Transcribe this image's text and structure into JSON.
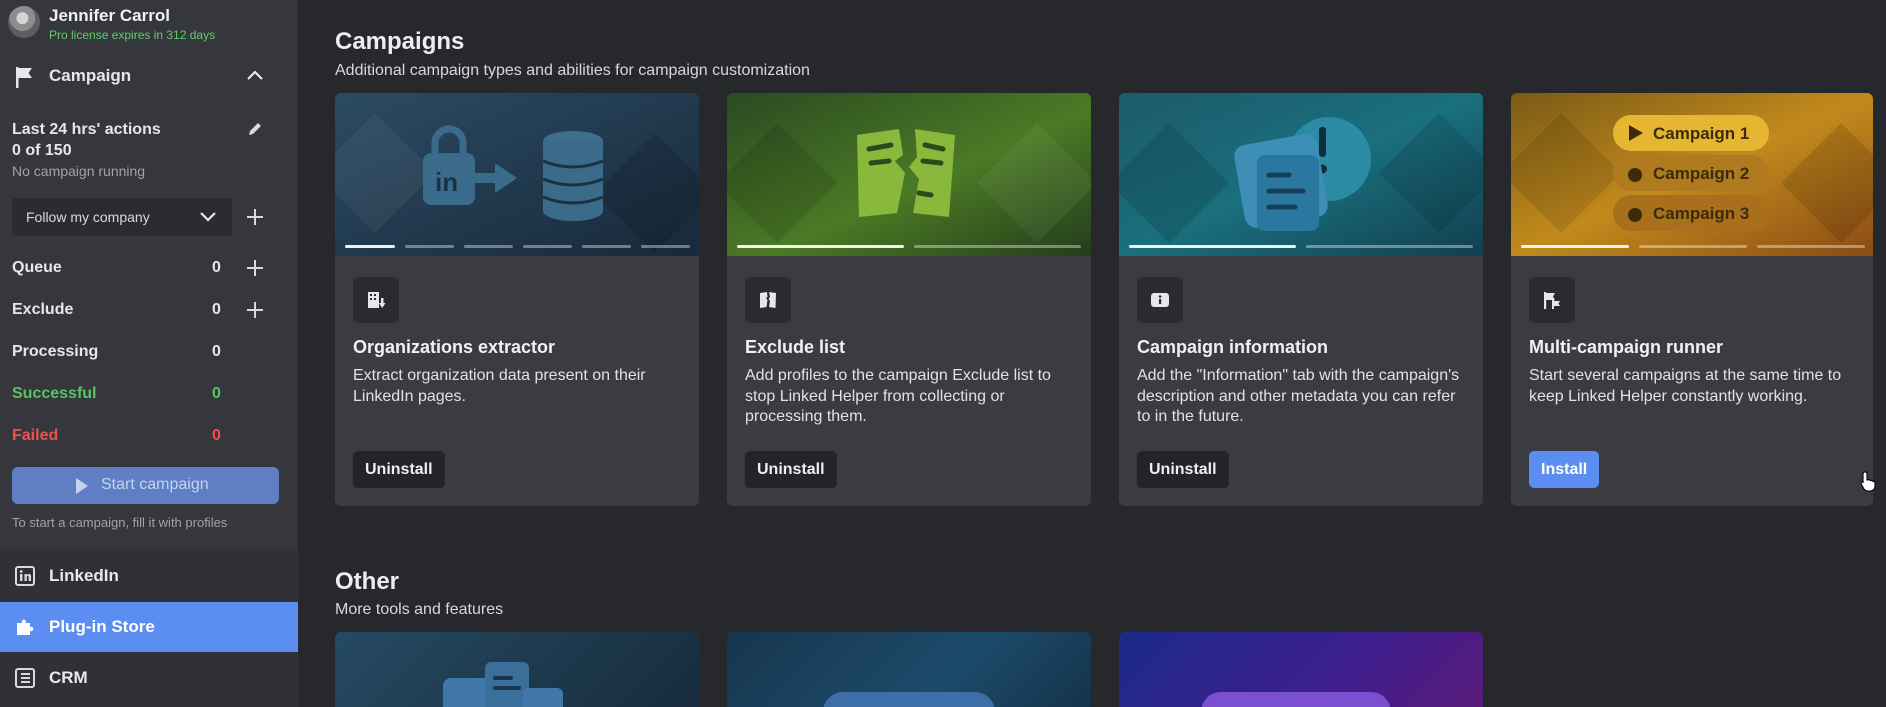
{
  "user": {
    "name": "Jennifer Carrol",
    "license": "Pro license expires in 312 days"
  },
  "sidebar": {
    "section_label": "Campaign",
    "actions_title": "Last 24 hrs' actions",
    "actions_count": "0 of 150",
    "status_text": "No campaign running",
    "campaign_select": "Follow my company",
    "stats": [
      {
        "label": "Queue",
        "value": "0"
      },
      {
        "label": "Exclude",
        "value": "0"
      },
      {
        "label": "Processing",
        "value": "0"
      },
      {
        "label": "Successful",
        "value": "0"
      },
      {
        "label": "Failed",
        "value": "0"
      }
    ],
    "start_button": "Start campaign",
    "hint": "To start a campaign, fill it with profiles",
    "nav": [
      {
        "label": "LinkedIn",
        "icon": "linkedin-icon"
      },
      {
        "label": "Plug-in Store",
        "icon": "puzzle-icon",
        "active": true
      },
      {
        "label": "CRM",
        "icon": "crm-icon"
      }
    ]
  },
  "campaigns": {
    "title": "Campaigns",
    "subtitle": "Additional campaign types and abilities for campaign customization",
    "cards": [
      {
        "title": "Organizations extractor",
        "description": "Extract organization data present on their LinkedIn pages.",
        "button": "Uninstall",
        "icon": "building-download-icon",
        "slides": 6,
        "active_slide": 0
      },
      {
        "title": "Exclude list",
        "description": "Add profiles to the campaign Exclude list to stop Linked Helper from collecting or processing them.",
        "button": "Uninstall",
        "icon": "torn-list-icon",
        "slides": 2,
        "active_slide": 0
      },
      {
        "title": "Campaign information",
        "description": "Add the \"Information\" tab with the campaign's description and other metadata you can refer to in the future.",
        "button": "Uninstall",
        "icon": "info-icon",
        "slides": 2,
        "active_slide": 0
      },
      {
        "title": "Multi-campaign runner",
        "description": "Start several campaigns at the same time to keep Linked Helper constantly working.",
        "button": "Install",
        "icon": "multi-flag-icon",
        "slides": 3,
        "active_slide": 0
      }
    ],
    "banner_pills": [
      "Campaign 1",
      "Campaign 2",
      "Campaign 3"
    ]
  },
  "other": {
    "title": "Other",
    "subtitle": "More tools and features"
  },
  "colors": {
    "accent": "#5b8ef0",
    "success": "#58c464",
    "danger": "#f0504f",
    "license": "#5dd06a"
  }
}
